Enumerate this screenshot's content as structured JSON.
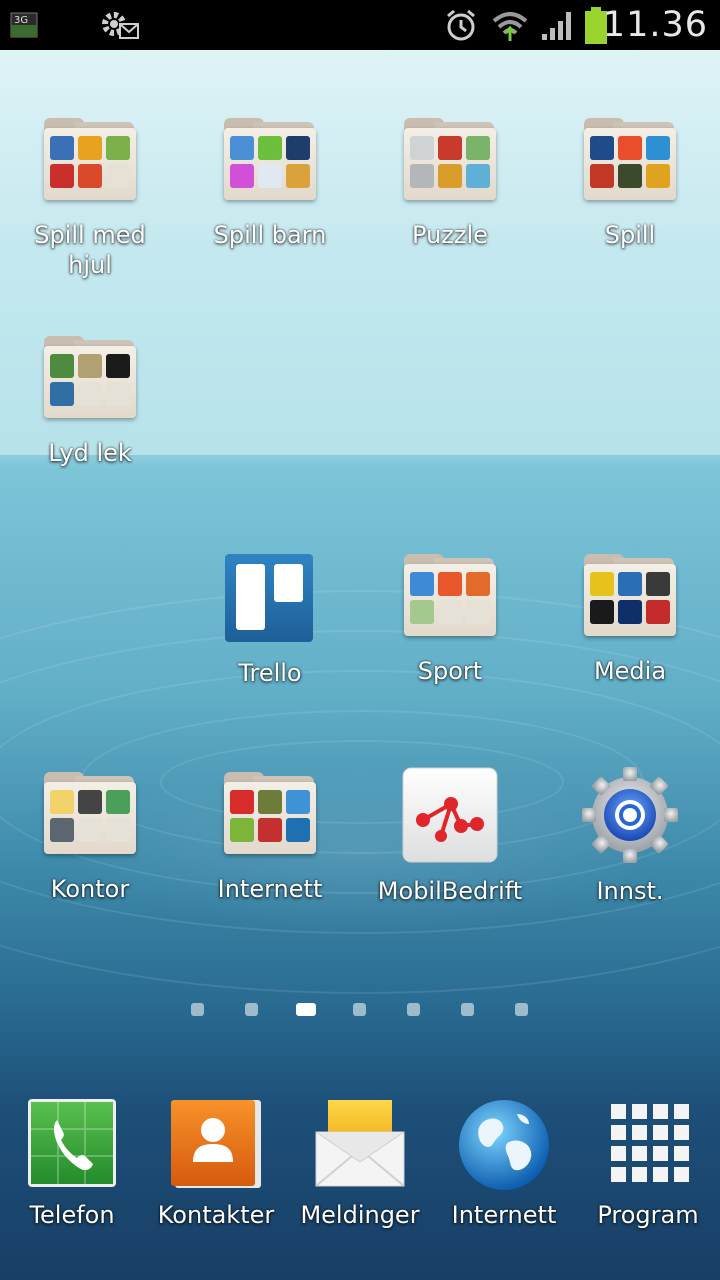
{
  "status_bar": {
    "network_type": "3G",
    "clock": "11.36",
    "battery_color": "#9bd32e",
    "icons": [
      "network-3g-icon",
      "settings-notification-icon",
      "alarm-icon",
      "wifi-icon",
      "signal-icon",
      "battery-icon"
    ]
  },
  "home": {
    "items": [
      {
        "label": "Spill med hjul",
        "line1": "Spill med",
        "line2": "hjul",
        "kind": "folder",
        "thumbs": [
          "#3b6fb6",
          "#e9a21f",
          "#7bb04a",
          "#c9302c",
          "#d84a2a",
          "#e6e1d6"
        ]
      },
      {
        "label": "Spill barn",
        "kind": "folder",
        "thumbs": [
          "#4a8fd6",
          "#6cbf3b",
          "#1f3d6b",
          "#d24fd8",
          "#e0e8f2",
          "#d9a23a"
        ]
      },
      {
        "label": "Puzzle",
        "kind": "folder",
        "thumbs": [
          "#cfd3d6",
          "#c83b2c",
          "#7ab46b",
          "#b3b7ba",
          "#d89d2a",
          "#5fb0d6"
        ]
      },
      {
        "label": "Spill",
        "kind": "folder",
        "thumbs": [
          "#1f4b8a",
          "#e94d2c",
          "#2e8fd3",
          "#c13926",
          "#3b4a2a",
          "#e0a320"
        ]
      },
      {
        "label": "Lyd lek",
        "kind": "folder",
        "thumbs": [
          "#4d8b3e",
          "#b0a072",
          "#1b1b1b",
          "#2f6fa3",
          "#e6e1d6",
          "#e6e1d6"
        ]
      },
      {
        "label": "Trello",
        "kind": "app"
      },
      {
        "label": "Sport",
        "kind": "folder",
        "thumbs": [
          "#3f8ad6",
          "#e8562b",
          "#e36a2a",
          "#a4c98d",
          "#e6e1d6",
          "#e6e1d6"
        ]
      },
      {
        "label": "Media",
        "kind": "folder",
        "thumbs": [
          "#e6c21c",
          "#2a6fb5",
          "#3a3a3a",
          "#1a1a1a",
          "#0f2f6b",
          "#c42b2b"
        ]
      },
      {
        "label": "Kontor",
        "kind": "folder",
        "thumbs": [
          "#f1d36a",
          "#444444",
          "#4c9f5a",
          "#5c6670",
          "#e6e1d6",
          "#e6e1d6"
        ]
      },
      {
        "label": "Internett",
        "kind": "folder",
        "thumbs": [
          "#d82b2b",
          "#6e7c3a",
          "#3d93d6",
          "#7db53a",
          "#c43030",
          "#1f6fb3"
        ]
      },
      {
        "label": "MobilBedrift",
        "kind": "app"
      },
      {
        "label": "Innst.",
        "kind": "app"
      }
    ]
  },
  "pages": {
    "count": 7,
    "active_index": 2
  },
  "dock": {
    "items": [
      {
        "label": "Telefon"
      },
      {
        "label": "Kontakter"
      },
      {
        "label": "Meldinger"
      },
      {
        "label": "Internett"
      },
      {
        "label": "Program"
      }
    ]
  }
}
